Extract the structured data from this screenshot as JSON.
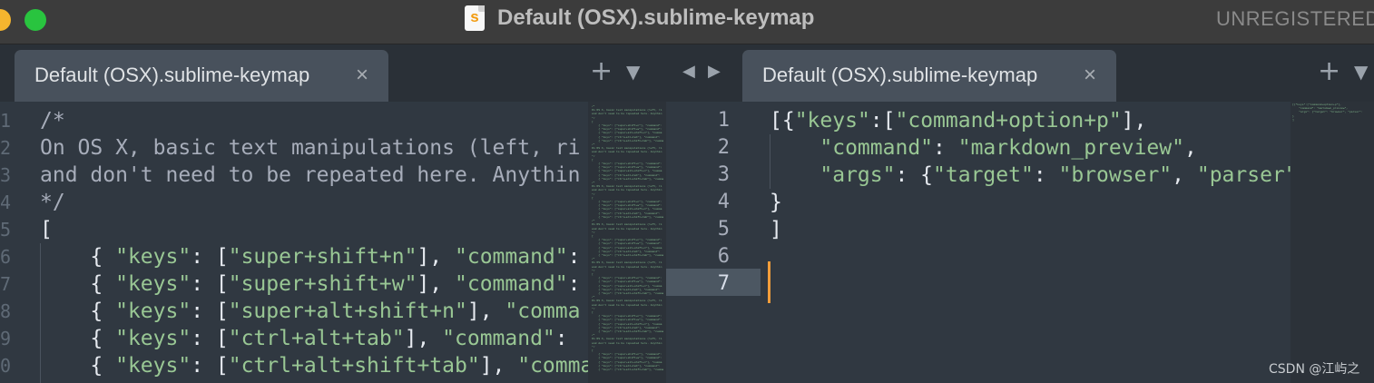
{
  "window": {
    "title": "Default (OSX).sublime-keymap",
    "registration": "UNREGISTERED",
    "app_icon_letter": "s"
  },
  "left_pane": {
    "tab_label": "Default (OSX).sublime-keymap",
    "tab_close": "×",
    "new_tab_icon": "+",
    "tab_menu_icon": "▼",
    "code_lines": [
      "/*",
      "On OS X, basic text manipulations (left, ri",
      "and don't need to be repeated here. Anythin",
      "*/",
      "[",
      "    { \"keys\": [\"super+shift+n\"], \"command\":",
      "    { \"keys\": [\"super+shift+w\"], \"command\":",
      "    { \"keys\": [\"super+alt+shift+n\"], \"comma",
      "    { \"keys\": [\"ctrl+alt+tab\"], \"command\": ",
      "    { \"keys\": [\"ctrl+alt+shift+tab\"], \"comma"
    ]
  },
  "right_pane": {
    "tab_label": "Default (OSX).sublime-keymap",
    "tab_close": "×",
    "new_tab_icon": "+",
    "tab_menu_icon": "▼",
    "nav_prev_icon": "◀",
    "nav_next_icon": "▶",
    "line_numbers": [
      "1",
      "2",
      "3",
      "4",
      "5",
      "6",
      "7"
    ],
    "current_line": "7",
    "code_lines": [
      "[{\"keys\":[\"command+option+p\"],",
      "    \"command\": \"markdown_preview\",",
      "    \"args\": {\"target\": \"browser\", \"parser\":",
      "}",
      "]",
      "",
      ""
    ]
  },
  "watermark": "CSDN @江屿之",
  "colors": {
    "background": "#303841",
    "string": "#99c794",
    "comment": "#a7adba",
    "cursor": "#f29d3a"
  }
}
